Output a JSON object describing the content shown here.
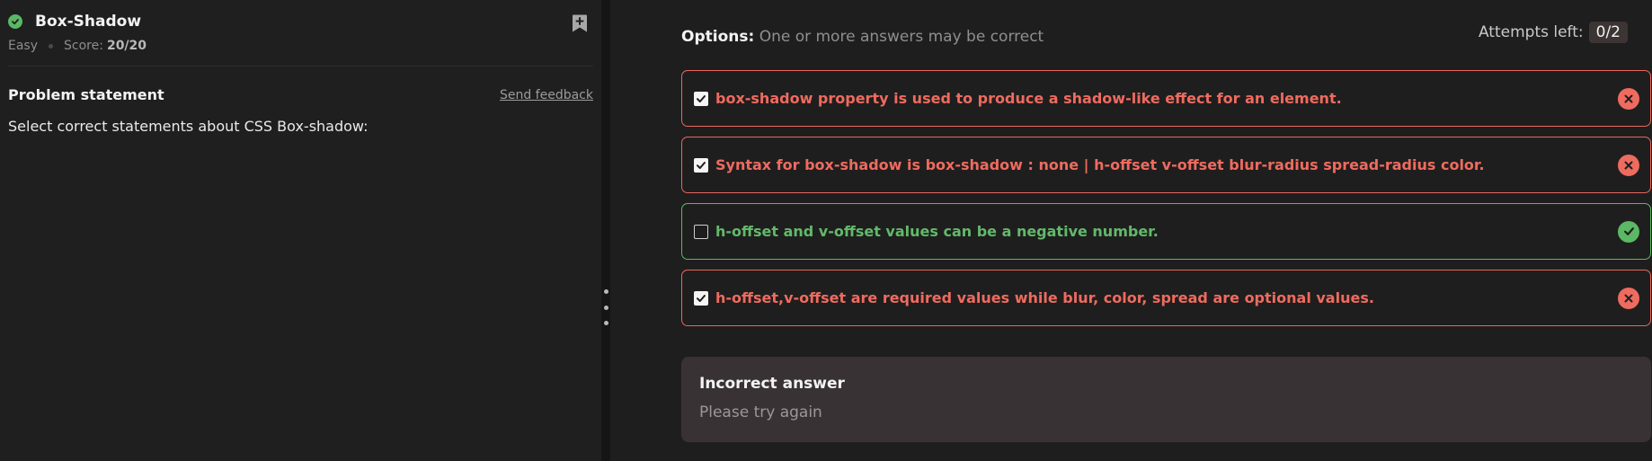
{
  "problem": {
    "title": "Box-Shadow",
    "difficulty": "Easy",
    "score_label": "Score:",
    "score_value": "20/20"
  },
  "statement": {
    "heading": "Problem statement",
    "feedback_link": "Send feedback",
    "text": "Select correct statements about CSS Box-shadow:"
  },
  "options": {
    "label": "Options:",
    "sub": "One or more answers may be correct",
    "attempts_label": "Attempts left:",
    "attempts_value": "0/2",
    "items": [
      {
        "text": "box-shadow property is used to produce a shadow-like effect for an element.",
        "checked": true,
        "status": "wrong"
      },
      {
        "text": "Syntax for box-shadow is box-shadow : none | h-offset v-offset blur-radius spread-radius color.",
        "checked": true,
        "status": "wrong"
      },
      {
        "text": "h-offset and v-offset values can be a negative number.",
        "checked": false,
        "status": "correct"
      },
      {
        "text": "h-offset,v-offset are required values while blur, color, spread are optional values.",
        "checked": true,
        "status": "wrong"
      }
    ]
  },
  "result": {
    "title": "Incorrect answer",
    "subtitle": "Please try again"
  },
  "colors": {
    "wrong": "#ee6b5f",
    "correct": "#5bb865",
    "background": "#1f1e1e"
  }
}
